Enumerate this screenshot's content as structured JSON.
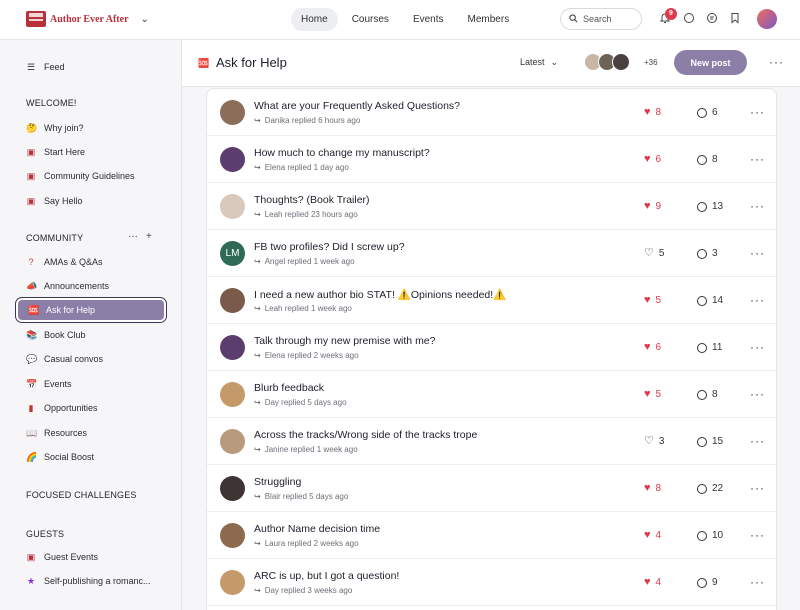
{
  "brand": {
    "name": "Author Ever After"
  },
  "topnav": {
    "items": [
      "Home",
      "Courses",
      "Events",
      "Members"
    ],
    "active": "Home"
  },
  "search": {
    "placeholder": "Search"
  },
  "notifications": {
    "count": "9"
  },
  "sidebar": {
    "feed_label": "Feed",
    "welcome_heading": "WELCOME!",
    "welcome_items": [
      {
        "label": "Why join?",
        "icon": "thinking-emoji-icon"
      },
      {
        "label": "Start Here",
        "icon": "typewriter-icon"
      },
      {
        "label": "Community Guidelines",
        "icon": "typewriter-icon"
      },
      {
        "label": "Say Hello",
        "icon": "typewriter-icon"
      }
    ],
    "community_heading": "COMMUNITY",
    "community_items": [
      {
        "label": "AMAs & Q&As",
        "icon": "question-mark-icon"
      },
      {
        "label": "Announcements",
        "icon": "megaphone-icon"
      },
      {
        "label": "Ask for Help",
        "icon": "help-icon",
        "active": true
      },
      {
        "label": "Book Club",
        "icon": "books-icon"
      },
      {
        "label": "Casual convos",
        "icon": "speech-bubble-icon"
      },
      {
        "label": "Events",
        "icon": "calendar-icon"
      },
      {
        "label": "Opportunities",
        "icon": "book-icon"
      },
      {
        "label": "Resources",
        "icon": "open-book-icon"
      },
      {
        "label": "Social Boost",
        "icon": "rainbow-icon"
      }
    ],
    "focused_heading": "FOCUSED CHALLENGES",
    "guests_heading": "GUESTS",
    "guests_items": [
      {
        "label": "Guest Events",
        "icon": "typewriter-icon"
      },
      {
        "label": "Self-publishing a romanc...",
        "icon": "star-icon"
      }
    ]
  },
  "content_header": {
    "title": "Ask for Help",
    "sort_label": "Latest",
    "member_more": "+36",
    "new_post_label": "New post"
  },
  "posts": [
    {
      "title": "What are your Frequently Asked Questions?",
      "replier": "Danika replied 6 hours ago",
      "likes": "8",
      "liked": true,
      "comments": "6"
    },
    {
      "title": "How much to change my manuscript?",
      "replier": "Elena replied 1 day ago",
      "likes": "6",
      "liked": true,
      "comments": "8"
    },
    {
      "title": "Thoughts? (Book Trailer)",
      "replier": "Leah replied 23 hours ago",
      "likes": "9",
      "liked": true,
      "comments": "13"
    },
    {
      "title": "FB two profiles? Did I screw up?",
      "replier": "Angel replied 1 week ago",
      "likes": "5",
      "liked": false,
      "comments": "3",
      "avatar_initials": "LM"
    },
    {
      "title": "I need a new author bio STAT! ⚠️Opinions needed!⚠️",
      "replier": "Leah replied 1 week ago",
      "likes": "5",
      "liked": true,
      "comments": "14"
    },
    {
      "title": "Talk through my new premise with me?",
      "replier": "Elena replied 2 weeks ago",
      "likes": "6",
      "liked": true,
      "comments": "11"
    },
    {
      "title": "Blurb feedback",
      "replier": "Day replied 5 days ago",
      "likes": "5",
      "liked": true,
      "comments": "8"
    },
    {
      "title": "Across the tracks/Wrong side of the tracks trope",
      "replier": "Janine replied 1 week ago",
      "likes": "3",
      "liked": false,
      "comments": "15"
    },
    {
      "title": "Struggling",
      "replier": "Blair replied 5 days ago",
      "likes": "8",
      "liked": true,
      "comments": "22"
    },
    {
      "title": "Author Name decision time",
      "replier": "Laura replied 2 weeks ago",
      "likes": "4",
      "liked": true,
      "comments": "10"
    },
    {
      "title": "ARC is up, but I got a question!",
      "replier": "Day replied 3 weeks ago",
      "likes": "4",
      "liked": true,
      "comments": "9"
    }
  ],
  "colors": {
    "accent": "#8b7fa8",
    "like": "#e0394b",
    "brand": "#b8323c",
    "lm_avatar": "#2e6b57"
  }
}
